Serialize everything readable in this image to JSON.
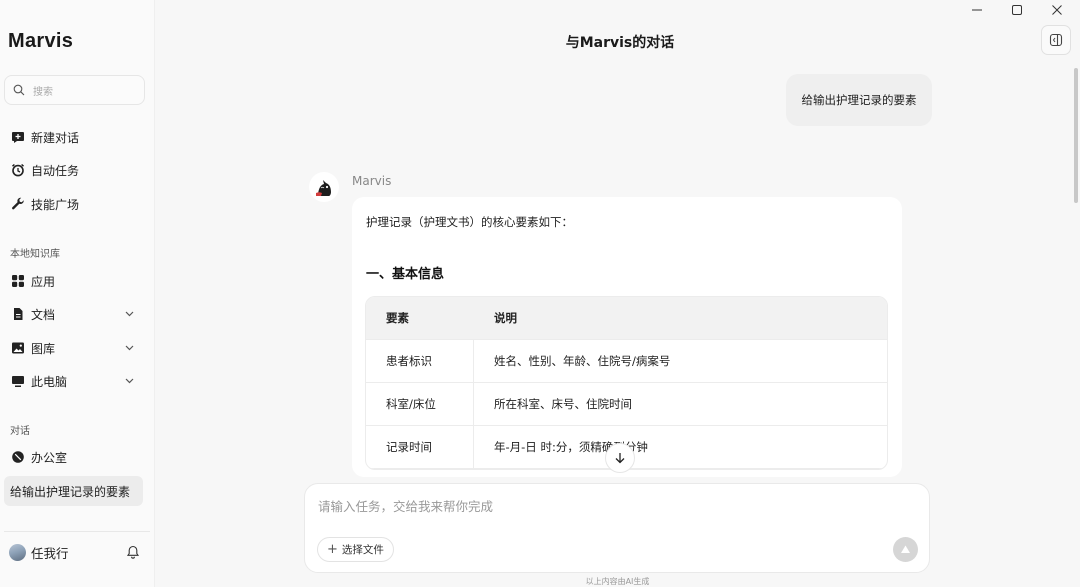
{
  "app": {
    "brand": "Marvis"
  },
  "search": {
    "placeholder": "搜索"
  },
  "nav": {
    "new_chat": "新建对话",
    "auto_tasks": "自动任务",
    "skills": "技能广场"
  },
  "kb": {
    "section": "本地知识库",
    "items": [
      {
        "label": "应用",
        "icon": "grid-icon"
      },
      {
        "label": "文档",
        "icon": "document-icon"
      },
      {
        "label": "图库",
        "icon": "image-icon"
      },
      {
        "label": "此电脑",
        "icon": "monitor-icon"
      }
    ]
  },
  "conversations": {
    "section": "对话",
    "office": "办公室",
    "active": "给输出护理记录的要素"
  },
  "user": {
    "name": "任我行"
  },
  "header": {
    "title": "与Marvis的对话"
  },
  "chat": {
    "user_message": "给输出护理记录的要素",
    "bot_name": "Marvis",
    "intro": "护理记录（护理文书）的核心要素如下：",
    "section_title": "一、基本信息",
    "table": {
      "headers": [
        "要素",
        "说明"
      ],
      "rows": [
        [
          "患者标识",
          "姓名、性别、年龄、住院号/病案号"
        ],
        [
          "科室/床位",
          "所在科室、床号、住院时间"
        ],
        [
          "记录时间",
          "年-月-日 时:分，须精确到分钟"
        ]
      ]
    }
  },
  "composer": {
    "placeholder": "请输入任务，交给我来帮你完成",
    "file_button": "选择文件"
  },
  "footer": {
    "disclaimer": "以上内容由AI生成"
  }
}
